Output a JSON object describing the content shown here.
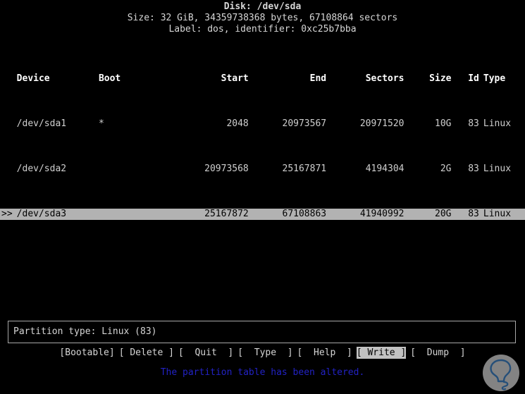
{
  "header": {
    "disk_line": "Disk: /dev/sda",
    "size_line": "Size: 32 GiB, 34359738368 bytes, 67108864 sectors",
    "label_line": "Label: dos, identifier: 0xc25b7bba"
  },
  "table": {
    "columns": {
      "cursor": "",
      "device": "Device",
      "boot": "Boot",
      "start": "Start",
      "end": "End",
      "sectors": "Sectors",
      "size": "Size",
      "id": "Id",
      "type": "Type"
    },
    "rows": [
      {
        "cursor": "",
        "device": "/dev/sda1",
        "boot": "*",
        "start": "2048",
        "end": "20973567",
        "sectors": "20971520",
        "size": "10G",
        "id": "83",
        "type": "Linux",
        "selected": false
      },
      {
        "cursor": "",
        "device": "/dev/sda2",
        "boot": "",
        "start": "20973568",
        "end": "25167871",
        "sectors": "4194304",
        "size": "2G",
        "id": "83",
        "type": "Linux",
        "selected": false
      },
      {
        "cursor": ">>",
        "device": "/dev/sda3",
        "boot": "",
        "start": "25167872",
        "end": "67108863",
        "sectors": "41940992",
        "size": "20G",
        "id": "83",
        "type": "Linux",
        "selected": true
      }
    ]
  },
  "partition_type_box": {
    "text": "Partition type: Linux (83)"
  },
  "menu": {
    "items": [
      {
        "label": "[Bootable]",
        "active": false
      },
      {
        "label": "[ Delete ]",
        "active": false
      },
      {
        "label": "[  Quit  ]",
        "active": false
      },
      {
        "label": "[  Type  ]",
        "active": false
      },
      {
        "label": "[  Help  ]",
        "active": false
      },
      {
        "label": "[ Write ]",
        "active": true
      },
      {
        "label": "[  Dump  ]",
        "active": false
      }
    ]
  },
  "status": {
    "message": "The partition table has been altered."
  },
  "colors": {
    "background": "#000000",
    "foreground": "#d6d6d6",
    "selection": "#b2b2b2",
    "status_blue": "#2222c4",
    "border": "#a8a8a8"
  },
  "watermark": {
    "name": "solvetic-logo"
  }
}
